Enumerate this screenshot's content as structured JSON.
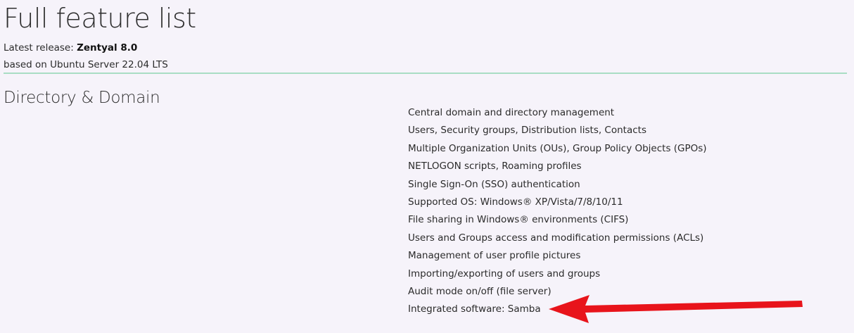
{
  "page": {
    "title": "Full feature list",
    "release_label": "Latest release:",
    "release_value": "Zentyal 8.0",
    "base": "based on Ubuntu Server 22.04 LTS"
  },
  "section": {
    "heading": "Directory & Domain",
    "features": [
      "Central domain and directory management",
      "Users, Security groups, Distribution lists, Contacts",
      "Multiple Organization Units (OUs), Group Policy Objects (GPOs)",
      "NETLOGON scripts, Roaming profiles",
      "Single Sign-On (SSO) authentication",
      "Supported OS: Windows® XP/Vista/7/8/10/11",
      "File sharing in Windows® environments (CIFS)",
      "Users and Groups access and modification permissions (ACLs)",
      "Management of user profile pictures",
      "Importing/exporting of users and groups",
      "Audit mode on/off (file server)",
      "Integrated software: Samba"
    ]
  },
  "annotation": {
    "arrow_color": "#e8141b",
    "arrow_icon": "red-arrow-pointing-left"
  }
}
